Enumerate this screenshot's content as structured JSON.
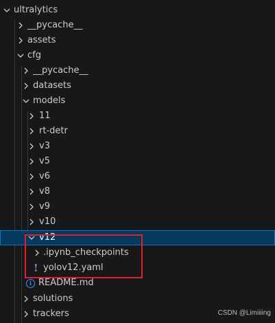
{
  "explorer": {
    "root": "ultralytics",
    "items": [
      {
        "label": "__pycache__"
      },
      {
        "label": "assets"
      },
      {
        "label": "cfg"
      },
      {
        "label": "__pycache__"
      },
      {
        "label": "datasets"
      },
      {
        "label": "models"
      },
      {
        "label": "11"
      },
      {
        "label": "rt-detr"
      },
      {
        "label": "v3"
      },
      {
        "label": "v5"
      },
      {
        "label": "v6"
      },
      {
        "label": "v8"
      },
      {
        "label": "v9"
      },
      {
        "label": "v10"
      },
      {
        "label": "v12"
      },
      {
        "label": ".ipynb_checkpoints"
      },
      {
        "label": "yolov12.yaml",
        "icon": "!"
      },
      {
        "label": "README.md",
        "icon": "i"
      },
      {
        "label": "solutions"
      },
      {
        "label": "trackers"
      }
    ],
    "selected": "v12"
  },
  "watermark": "CSDN @Limiiiing",
  "colors": {
    "background": "#181818",
    "text": "#cccccc",
    "selection": "#04395e",
    "highlight_box": "#e0212d",
    "yaml_icon": "#a074c4",
    "info_icon": "#3794ff"
  }
}
